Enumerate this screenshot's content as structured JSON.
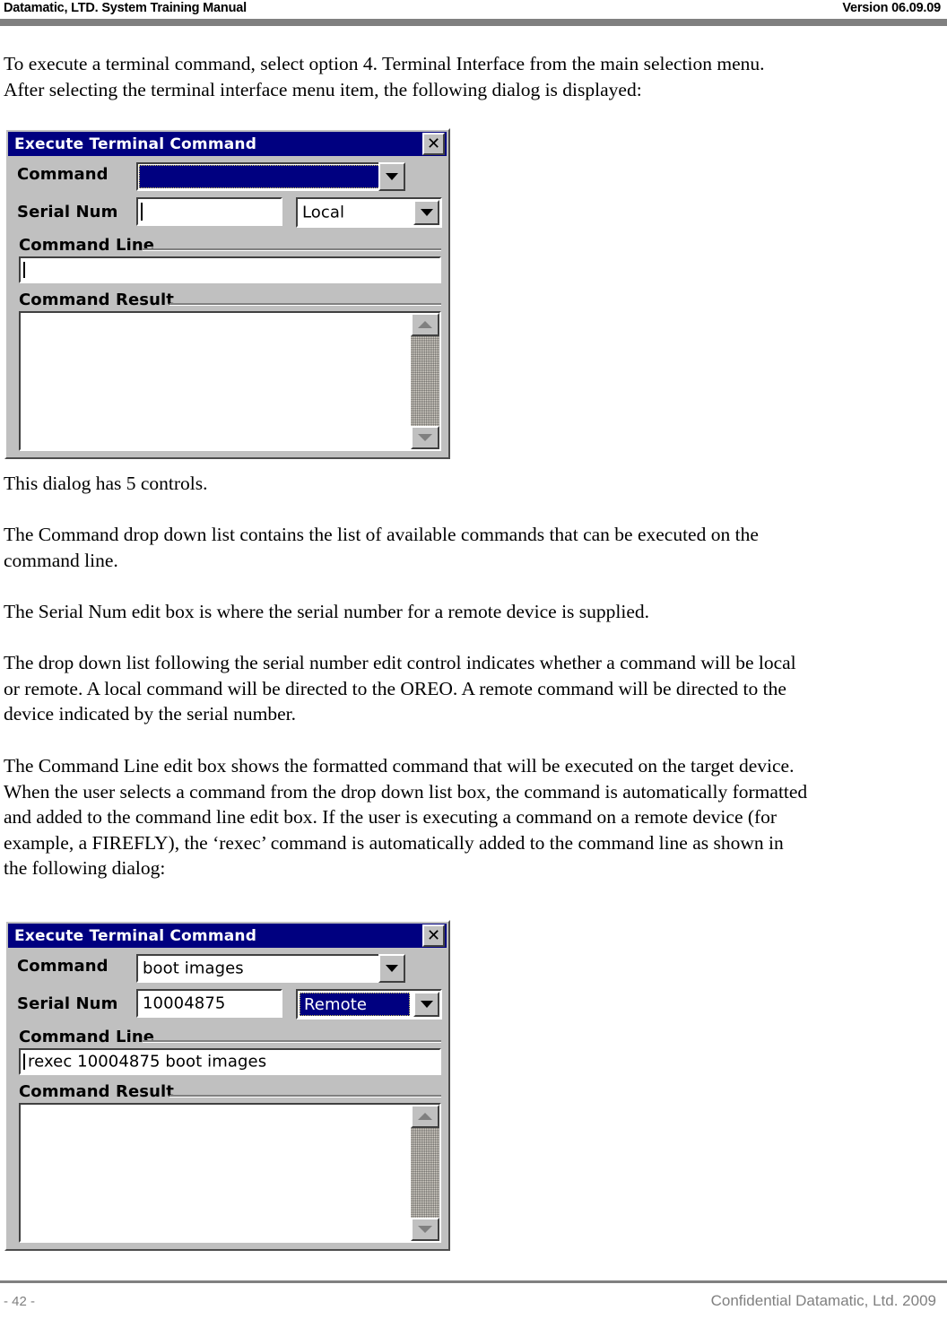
{
  "header": {
    "title": "Datamatic, LTD. System Training  Manual",
    "version": "Version 06.09.09"
  },
  "body": {
    "intro": [
      "To execute a terminal command, select option 4. Terminal Interface from the main selection menu.",
      "After selecting the terminal interface menu item, the following dialog is displayed:"
    ],
    "p_controls": [
      "This dialog has 5 controls."
    ],
    "p_command": [
      "The Command drop down list contains the list of available commands that can be executed on the",
      "command line."
    ],
    "p_serial": [
      "The Serial Num edit box is where the serial number for a remote device is supplied."
    ],
    "p_dropdown": [
      "The drop down list following the serial number edit control indicates whether a command will be local",
      "or remote.  A local command will be directed to the OREO.  A remote command will be directed to the",
      "device indicated by the serial number."
    ],
    "p_cmdline": [
      "The Command Line edit box shows the formatted command that will be executed on the target device.",
      "When the user selects a command from the drop down list box, the command is automatically formatted",
      "and added to the command line edit box.  If the user is executing a command on a remote device (for",
      "example, a FIREFLY), the ‘rexec’ command is automatically added to the command line as shown in",
      "the following dialog:"
    ]
  },
  "dialog1": {
    "title": "Execute Terminal Command",
    "close_label": "✕",
    "command_label": "Command",
    "command_value": "",
    "serial_label": "Serial Num",
    "serial_value": "",
    "scope_value": "Local",
    "cmdline_label": "Command Line",
    "cmdline_value": "",
    "result_label": "Command Result",
    "result_value": ""
  },
  "dialog2": {
    "title": "Execute Terminal Command",
    "close_label": "✕",
    "command_label": "Command",
    "command_value": "boot images",
    "serial_label": "Serial Num",
    "serial_value": "10004875",
    "scope_value": "Remote",
    "cmdline_label": "Command Line",
    "cmdline_value": "rexec 10004875 boot images",
    "result_label": "Command Result",
    "result_value": ""
  },
  "footer": {
    "page_number": "- 42 -",
    "confidential": "Confidential Datamatic, Ltd. 2009"
  },
  "colors": {
    "titlebar": "#000080",
    "dialog_face": "#c0c0c0",
    "rule": "#808080",
    "selection": "#000080"
  }
}
